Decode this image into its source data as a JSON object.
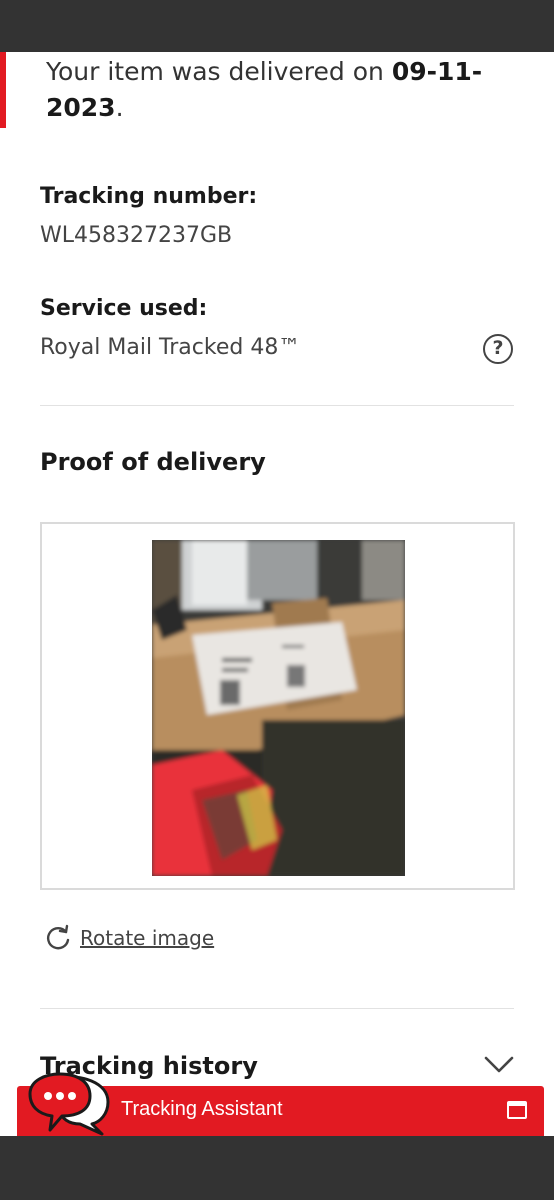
{
  "delivery": {
    "message_prefix": "Your item was delivered on ",
    "date": "09-11-2023",
    "suffix": "."
  },
  "tracking": {
    "label": "Tracking number:",
    "value": "WL458327237GB"
  },
  "service": {
    "label": "Service used:",
    "value": "Royal Mail Tracked 48™",
    "help_icon": "question-circle-icon",
    "help_symbol": "?"
  },
  "proof": {
    "title": "Proof of delivery",
    "rotate_label": "Rotate image"
  },
  "history": {
    "title": "Tracking history"
  },
  "assistant": {
    "label": "Tracking Assistant"
  },
  "colors": {
    "brand_red": "#e21a22",
    "system_bar": "#333333",
    "divider": "#e2e2e2"
  }
}
